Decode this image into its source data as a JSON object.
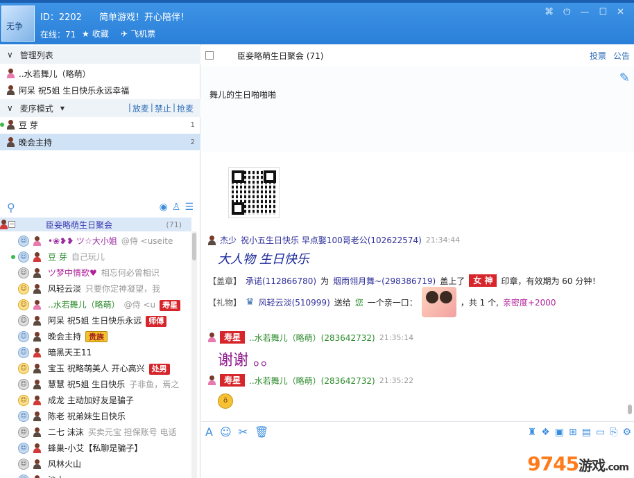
{
  "titlebar": {
    "id_text": "ID：2202",
    "slogan": "简单游戏！开心陪伴！",
    "online_text": "在线：71",
    "favorite_label": "收藏",
    "ticket_label": "飞机票",
    "avatar_text": "无争"
  },
  "left": {
    "admin_header": "管理列表",
    "admins": [
      {
        "name": "..水若舞儿（略萌）"
      },
      {
        "name": "阿呆   祝5姐  生日快乐永远幸福"
      }
    ],
    "mic_header": "麦序模式",
    "mic_links": [
      "放麦",
      "禁止",
      "抢麦"
    ],
    "mic_queue": [
      {
        "name": "豆   芽",
        "num": "1"
      },
      {
        "name": "晚会主持",
        "num": "2"
      }
    ],
    "room_title": "臣妾略萌生日聚会",
    "room_count": "(71)",
    "users": [
      {
        "name": "•❀❥❥ ツ☆大小姐",
        "msg": "@侍  <useite",
        "badge": ""
      },
      {
        "name": "豆   芽",
        "msg": "自己玩儿",
        "badge": ""
      },
      {
        "name": "ツ梦中情歌♥",
        "msg": "相忘何必曾相识",
        "badge": ""
      },
      {
        "name": "风轻云淡",
        "msg": "只要你定神凝望，我",
        "badge": ""
      },
      {
        "name": "..水若舞儿（略萌）",
        "msg": "@侍  <u",
        "badge": "寿星"
      },
      {
        "name": "阿呆   祝5姐  生日快乐永远",
        "msg": "",
        "badge": "师傅"
      },
      {
        "name": "晚会主持",
        "msg": "",
        "badge": "贵族"
      },
      {
        "name": "暗黑天王11",
        "msg": "",
        "badge": ""
      },
      {
        "name": "宝玉   祝略萌美人  开心高兴",
        "msg": "",
        "badge": "处男"
      },
      {
        "name": "慧慧   祝5姐  生日快乐",
        "msg": "子非鱼，焉之",
        "badge": ""
      },
      {
        "name": "成龙   主动加好友是骗子",
        "msg": "",
        "badge": ""
      },
      {
        "name": "陈老    祝弟妹生日快乐",
        "msg": "",
        "badge": ""
      },
      {
        "name": "二七   沫沫",
        "msg": "买卖元宝  担保账号  电话",
        "badge": ""
      },
      {
        "name": "蜂巢-小艾【私聊是骗子】",
        "msg": "",
        "badge": ""
      },
      {
        "name": "风林火山",
        "msg": "",
        "badge": ""
      },
      {
        "name": "沙土",
        "msg": "",
        "badge": ""
      }
    ]
  },
  "right": {
    "room_title": "臣妾略萌生日聚会 (71)",
    "links": [
      "投票",
      "公告"
    ],
    "notice_text": "舞儿的生日啪啪啪",
    "messages": {
      "m1_user": "杰少",
      "m1_text": "祝小五生日快乐   早点娶100哥老公(102622574)",
      "m1_time": "21:34:44",
      "m1_big": "大人物  生日快乐",
      "stamp_prefix": "【盖章】",
      "stamp_user": "承诺(112866780)",
      "stamp_mid": "为",
      "stamp_target": "烟雨翎月舞~(298386719)",
      "stamp_mid2": "盖上了",
      "stamp_label": "女 神",
      "stamp_suffix": "印章，有效期为 60 分钟！",
      "gift_prefix": "【礼物】",
      "gift_user": "风轻云淡(510999)",
      "gift_mid": "送给",
      "gift_you": "您",
      "gift_what": "一个亲一口：",
      "gift_count": "，共 1 个,",
      "gift_intimacy": "亲密度+2000",
      "m2_badge": "寿星",
      "m2_user": "..水若舞儿（略萌）(283642732)",
      "m2_time": "21:35:14",
      "m2_text": "谢谢  。。",
      "m3_badge": "寿星",
      "m3_user": "..水若舞儿（略萌）(283642732)",
      "m3_time": "21:35:22"
    }
  },
  "watermark": {
    "num": "9745",
    "cn": "游戏",
    "dotcom": ".com"
  },
  "colors": {
    "titlebar": "#2a7fd8",
    "badge_red": "#d6262c",
    "link_blue": "#2e6db8"
  }
}
